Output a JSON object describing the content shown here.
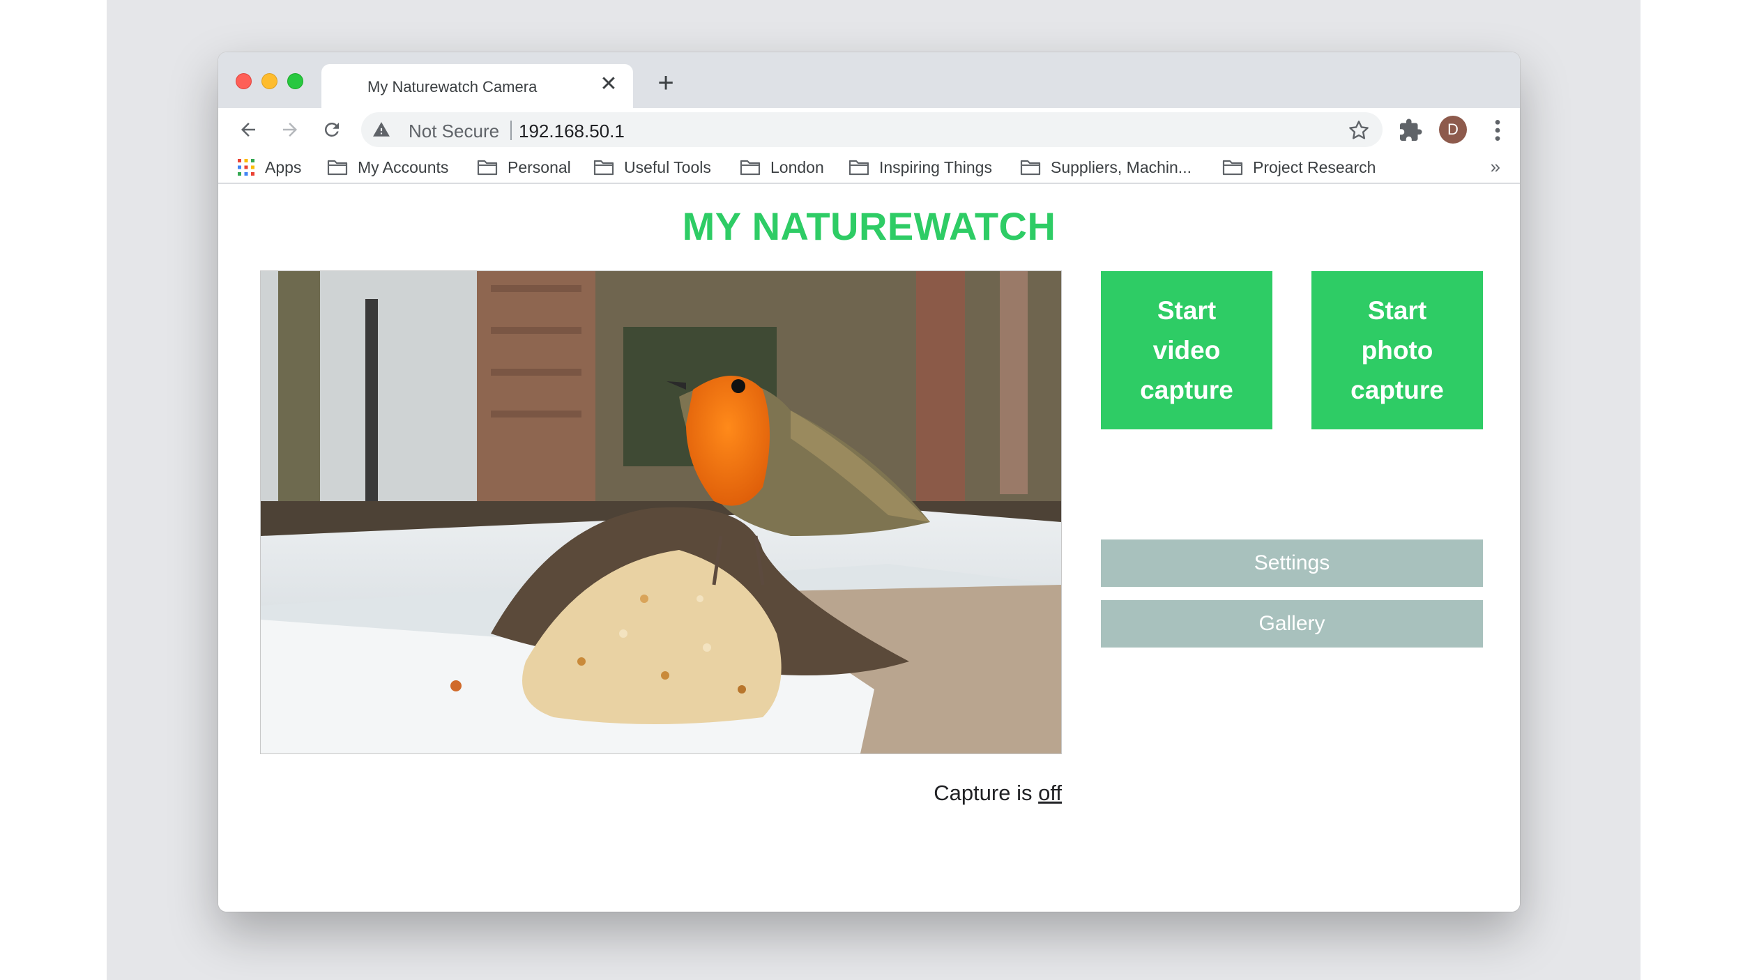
{
  "browser": {
    "tab_title": "My Naturewatch Camera",
    "tab_close_glyph": "✕",
    "new_tab_glyph": "+",
    "security_label": "Not Secure",
    "url": "192.168.50.1",
    "avatar_initial": "D",
    "bookmarks": [
      {
        "label": "Apps",
        "icon": "apps-grid-icon"
      },
      {
        "label": "My Accounts",
        "icon": "folder-icon"
      },
      {
        "label": "Personal",
        "icon": "folder-icon"
      },
      {
        "label": "Useful Tools",
        "icon": "folder-icon"
      },
      {
        "label": "London",
        "icon": "folder-icon"
      },
      {
        "label": "Inspiring Things",
        "icon": "folder-icon"
      },
      {
        "label": "Suppliers, Machin...",
        "icon": "folder-icon"
      },
      {
        "label": "Project Research",
        "icon": "folder-icon"
      }
    ],
    "bookmarks_overflow": "»"
  },
  "page": {
    "title": "MY NATUREWATCH",
    "start_video_label": "Start video capture",
    "start_photo_label": "Start photo capture",
    "settings_label": "Settings",
    "gallery_label": "Gallery",
    "capture_status_prefix": "Capture is ",
    "capture_state": "off"
  },
  "colors": {
    "accent_green": "#2ecc65",
    "secondary_button": "#a8c1bd"
  }
}
